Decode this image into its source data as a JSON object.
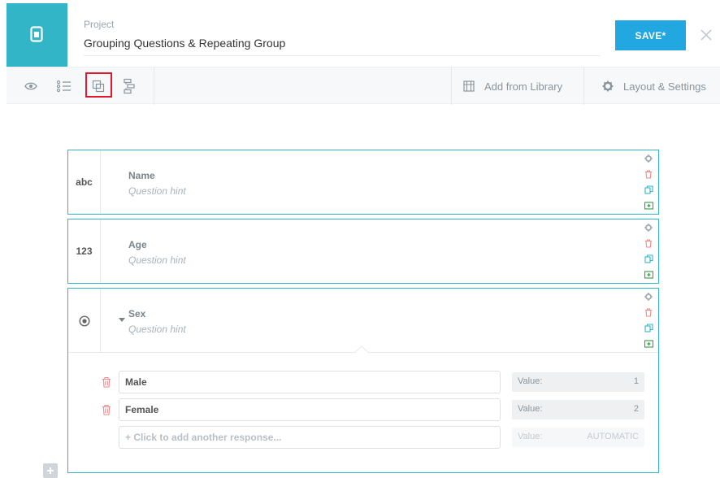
{
  "header": {
    "project_label": "Project",
    "project_title": "Grouping Questions & Repeating Group",
    "save_label": "SAVE*",
    "brand_color": "#33b5c8",
    "save_color": "#22a7e0"
  },
  "toolbar": {
    "icons": [
      "eye-icon",
      "list-icon",
      "group-icon",
      "branching-icon"
    ],
    "highlighted_icon": "group-icon",
    "add_from_library": "Add from Library",
    "layout_settings": "Layout & Settings"
  },
  "questions": [
    {
      "type_label": "abc",
      "label": "Name",
      "hint": "Question hint"
    },
    {
      "type_label": "123",
      "label": "Age",
      "hint": "Question hint"
    },
    {
      "type_label": "",
      "type_icon": "radio-icon",
      "label": "Sex",
      "hint": "Question hint"
    }
  ],
  "choices": [
    {
      "label": "Male",
      "value_label": "Value:",
      "value": "1"
    },
    {
      "label": "Female",
      "value_label": "Value:",
      "value": "2"
    }
  ],
  "add_choice": {
    "placeholder": "+ Click to add another response...",
    "value_label": "Value:",
    "value": "AUTOMATIC"
  }
}
